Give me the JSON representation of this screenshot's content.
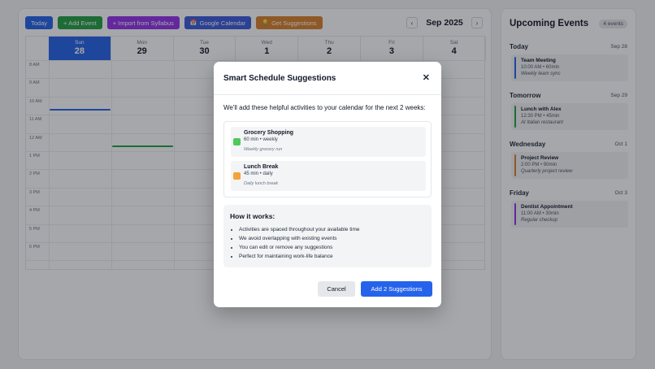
{
  "toolbar": {
    "buttons": [
      {
        "label": "Today",
        "icon": "",
        "color": "#2563eb"
      },
      {
        "label": "+ Add Event",
        "icon": "",
        "color": "#22a045"
      },
      {
        "label": "+ Import from Syllabus",
        "icon": "",
        "color": "#9333ea"
      },
      {
        "label": "Google Calendar",
        "icon": "📅",
        "color": "#3b5bdb"
      },
      {
        "label": "Get Suggestions",
        "icon": "💡",
        "color": "#d9822b"
      }
    ]
  },
  "calendar": {
    "month_label": "Sep 2025",
    "prev_icon": "‹",
    "next_icon": "›",
    "days": [
      {
        "name": "Sun",
        "date": "28",
        "active": true
      },
      {
        "name": "Mon",
        "date": "29",
        "active": false
      },
      {
        "name": "Tue",
        "date": "30",
        "active": false
      },
      {
        "name": "Wed",
        "date": "1",
        "active": false
      },
      {
        "name": "Thu",
        "date": "2",
        "active": false
      },
      {
        "name": "Fri",
        "date": "3",
        "active": false
      },
      {
        "name": "Sat",
        "date": "4",
        "active": false
      }
    ],
    "times": [
      "8 AM",
      "9 AM",
      "10 AM",
      "11 AM",
      "12 AM",
      "1 PM",
      "2 PM",
      "3 PM",
      "4 PM",
      "5 PM",
      "6 PM"
    ],
    "event_marks": [
      {
        "day": 0,
        "time_index": 2,
        "color": "#2563eb"
      },
      {
        "day": 1,
        "time_index": 4,
        "color": "#22a045"
      }
    ]
  },
  "sidebar": {
    "title": "Upcoming Events",
    "count": "4 events",
    "groups": [
      {
        "label": "Today",
        "date": "Sep 28",
        "event": {
          "title": "Team Meeting",
          "meta": "10:00 AM • 60min",
          "note": "Weekly team sync",
          "color": "#2563eb"
        }
      },
      {
        "label": "Tomorrow",
        "date": "Sep 29",
        "event": {
          "title": "Lunch with Alex",
          "meta": "12:30 PM • 45min",
          "note": "At Italian restaurant",
          "color": "#22a045"
        }
      },
      {
        "label": "Wednesday",
        "date": "Oct 1",
        "event": {
          "title": "Project Review",
          "meta": "2:00 PM • 90min",
          "note": "Quarterly project review",
          "color": "#d9822b"
        }
      },
      {
        "label": "Friday",
        "date": "Oct 3",
        "event": {
          "title": "Dentist Appointment",
          "meta": "11:00 AM • 30min",
          "note": "Regular checkup",
          "color": "#9333ea"
        }
      }
    ]
  },
  "modal": {
    "title": "Smart Schedule Suggestions",
    "close_icon": "✕",
    "intro": "We'll add these helpful activities to your calendar for the next 2 weeks:",
    "suggestions": [
      {
        "name": "Grocery Shopping",
        "meta": "60 min • weekly",
        "desc": "Weekly grocery run",
        "color": "#4ec95a"
      },
      {
        "name": "Lunch Break",
        "meta": "45 min • daily",
        "desc": "Daily lunch break",
        "color": "#f4a23a"
      }
    ],
    "how_title": "How it works:",
    "how_items": [
      "Activities are spaced throughout your available time",
      "We avoid overlapping with existing events",
      "You can edit or remove any suggestions",
      "Perfect for maintaining work-life balance"
    ],
    "cancel_label": "Cancel",
    "add_label": "Add 2 Suggestions"
  }
}
